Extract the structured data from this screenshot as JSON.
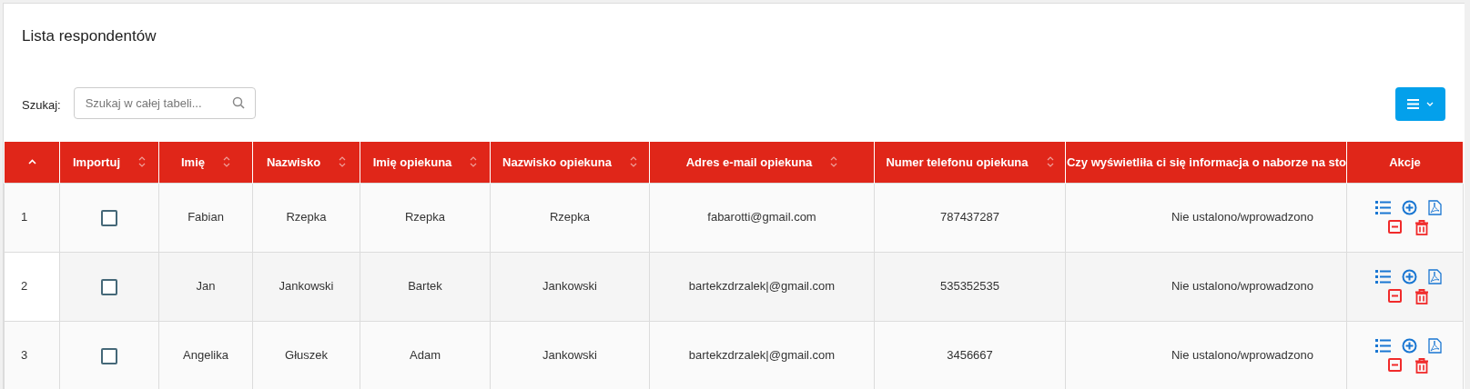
{
  "title": "Lista respondentów",
  "search": {
    "label": "Szukaj:",
    "placeholder": "Szukaj w całej tabeli..."
  },
  "table": {
    "columns": [
      {
        "sorted": true
      },
      {
        "label": "Importuj",
        "sorted": false
      },
      {
        "label": "Imię",
        "sorted": false
      },
      {
        "label": "Nazwisko",
        "sorted": false
      },
      {
        "label": "Imię opiekuna",
        "sorted": false
      },
      {
        "label": "Nazwisko opiekuna",
        "sorted": false
      },
      {
        "label": "Adres e-mail opiekuna",
        "sorted": false
      },
      {
        "label": "Numer telefonu opiekuna",
        "sorted": false
      },
      {
        "label": "Czy wyświetliła ci się informacja o naborze na sto"
      },
      {
        "label": "Akcje"
      }
    ],
    "rows": [
      {
        "cells": [
          {
            "kind": "text",
            "text": "1"
          },
          {
            "kind": "checkbox",
            "checked": false
          },
          {
            "kind": "text",
            "text": "Fabian"
          },
          {
            "kind": "text",
            "text": "Rzepka"
          },
          {
            "kind": "text",
            "text": "Rzepka"
          },
          {
            "kind": "text",
            "text": "Rzepka"
          },
          {
            "kind": "text",
            "text": "fabarotti@gmail.com"
          },
          {
            "kind": "text",
            "text": "787437287"
          },
          {
            "kind": "text",
            "text": "Nie ustalono/wprowadzono"
          },
          {
            "kind": "actions"
          }
        ]
      },
      {
        "cells": [
          {
            "kind": "text",
            "text": "2"
          },
          {
            "kind": "checkbox",
            "checked": false
          },
          {
            "kind": "text",
            "text": "Jan"
          },
          {
            "kind": "text",
            "text": "Jankowski"
          },
          {
            "kind": "text",
            "text": "Bartek"
          },
          {
            "kind": "text",
            "text": "Jankowski"
          },
          {
            "kind": "text",
            "text": "bartekzdrzalek|@gmail.com"
          },
          {
            "kind": "text",
            "text": "535352535"
          },
          {
            "kind": "text",
            "text": "Nie ustalono/wprowadzono"
          },
          {
            "kind": "actions"
          }
        ]
      },
      {
        "cells": [
          {
            "kind": "text",
            "text": "3"
          },
          {
            "kind": "checkbox",
            "checked": false
          },
          {
            "kind": "text",
            "text": "Angelika"
          },
          {
            "kind": "text",
            "text": "Głuszek"
          },
          {
            "kind": "text",
            "text": "Adam"
          },
          {
            "kind": "text",
            "text": "Jankowski"
          },
          {
            "kind": "text",
            "text": "bartekzdrzalek|@gmail.com"
          },
          {
            "kind": "text",
            "text": "3456667"
          },
          {
            "kind": "text",
            "text": "Nie ustalono/wprowadzono"
          },
          {
            "kind": "actions"
          }
        ]
      }
    ]
  }
}
